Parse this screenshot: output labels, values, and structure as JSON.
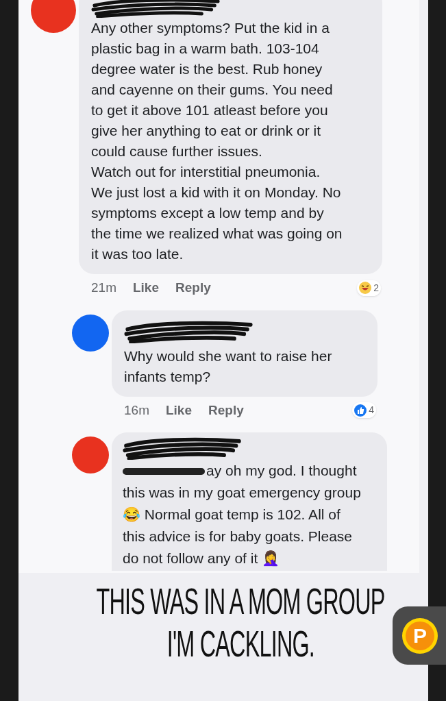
{
  "comments": [
    {
      "color": "#e8321f",
      "mention_redacted": false,
      "text": "Any other symptoms? Put the kid in a plastic bag in a warm bath. 103-104 degree water is the best. Rub honey and cayenne on their gums. You need to get it above 101 atleast before you give her anything to eat or drink or it could cause further issues.\nWatch out for interstitial pneumonia. We just lost a kid with it on Monday. No symptoms except a low temp and by the time we realized what was going on it was too late.",
      "time": "21m",
      "actions": [
        "Like",
        "Reply"
      ],
      "reaction": {
        "kind": "haha",
        "count": "2"
      }
    },
    {
      "color": "#1266f1",
      "mention_redacted": false,
      "text": "Why would she want to raise her infants temp?",
      "time": "16m",
      "actions": [
        "Like",
        "Reply"
      ],
      "reaction": {
        "kind": "like",
        "count": "4"
      }
    },
    {
      "color": "#e8321f",
      "mention_redacted": true,
      "text": "ay oh my god. I thought this was in my goat emergency group 😂 Normal goat temp is 102. All of this advice is for baby goats. Please do not follow any of it 🤦‍♀️"
    }
  ],
  "caption": [
    "THIS WAS IN A MOM GROUP",
    "I'M CACKLING."
  ],
  "floating_button": {
    "label": "P"
  }
}
